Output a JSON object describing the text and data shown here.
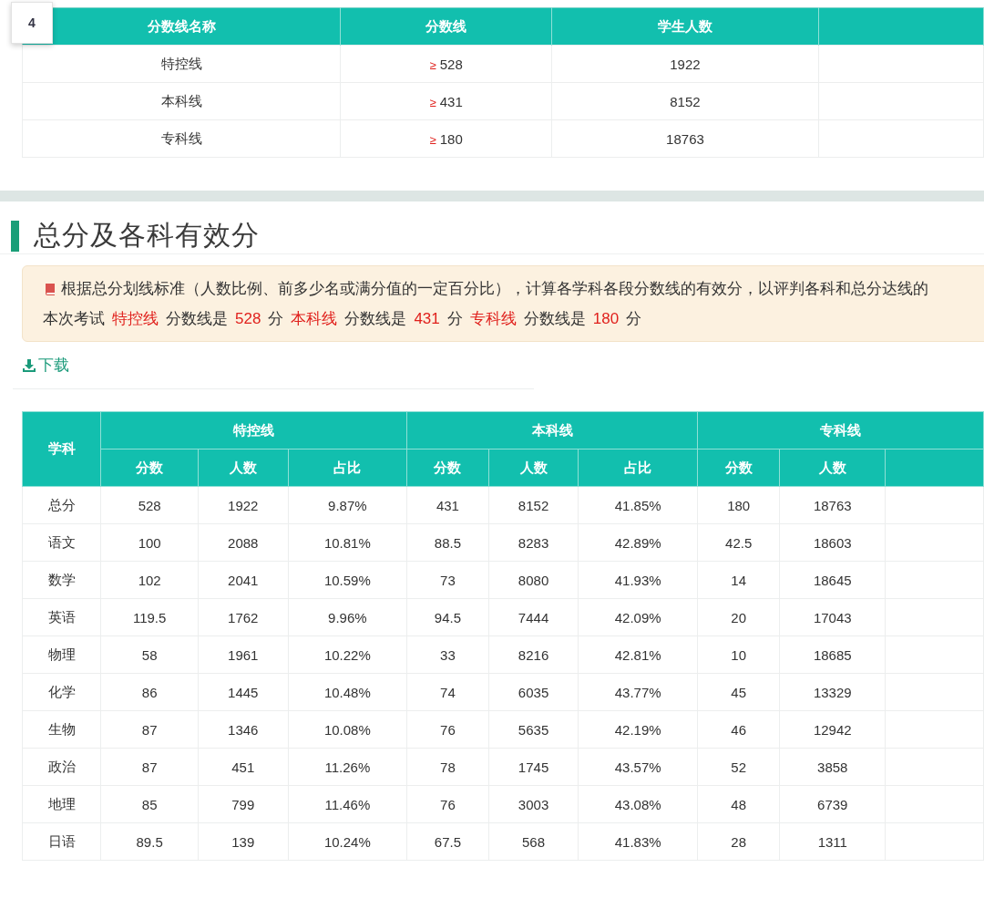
{
  "page_badge": "4",
  "cutoff_table": {
    "columns": [
      "分数线名称",
      "分数线",
      "学生人数"
    ],
    "rows": [
      {
        "name": "特控线",
        "sign": "≥",
        "score": "528",
        "students": "1922"
      },
      {
        "name": "本科线",
        "sign": "≥",
        "score": "431",
        "students": "8152"
      },
      {
        "name": "专科线",
        "sign": "≥",
        "score": "180",
        "students": "18763"
      }
    ]
  },
  "section": {
    "title": "总分及各科有效分",
    "notice": {
      "text": "根据总分划线标准（人数比例、前多少名或满分值的一定百分比），计算各学科各段分数线的有效分，以评判各科和总分达线的",
      "summary_prefix": "本次考试",
      "lines": [
        {
          "name": "特控线",
          "text": "分数线是",
          "score": "528",
          "unit": "分"
        },
        {
          "name": "本科线",
          "text": "分数线是",
          "score": "431",
          "unit": "分"
        },
        {
          "name": "专科线",
          "text": "分数线是",
          "score": "180",
          "unit": "分"
        }
      ]
    },
    "download": "下载",
    "table": {
      "subject_header": "学科",
      "groups": [
        {
          "name": "特控线",
          "columns": [
            "分数",
            "人数",
            "占比"
          ]
        },
        {
          "name": "本科线",
          "columns": [
            "分数",
            "人数",
            "占比"
          ]
        },
        {
          "name": "专科线",
          "columns": [
            "分数",
            "人数"
          ]
        }
      ],
      "rows": [
        [
          "总分",
          "528",
          "1922",
          "9.87%",
          "431",
          "8152",
          "41.85%",
          "180",
          "18763"
        ],
        [
          "语文",
          "100",
          "2088",
          "10.81%",
          "88.5",
          "8283",
          "42.89%",
          "42.5",
          "18603"
        ],
        [
          "数学",
          "102",
          "2041",
          "10.59%",
          "73",
          "8080",
          "41.93%",
          "14",
          "18645"
        ],
        [
          "英语",
          "119.5",
          "1762",
          "9.96%",
          "94.5",
          "7444",
          "42.09%",
          "20",
          "17043"
        ],
        [
          "物理",
          "58",
          "1961",
          "10.22%",
          "33",
          "8216",
          "42.81%",
          "10",
          "18685"
        ],
        [
          "化学",
          "86",
          "1445",
          "10.48%",
          "74",
          "6035",
          "43.77%",
          "45",
          "13329"
        ],
        [
          "生物",
          "87",
          "1346",
          "10.08%",
          "76",
          "5635",
          "42.19%",
          "46",
          "12942"
        ],
        [
          "政治",
          "87",
          "451",
          "11.26%",
          "78",
          "1745",
          "43.57%",
          "52",
          "3858"
        ],
        [
          "地理",
          "85",
          "799",
          "11.46%",
          "76",
          "3003",
          "43.08%",
          "48",
          "6739"
        ],
        [
          "日语",
          "89.5",
          "139",
          "10.24%",
          "67.5",
          "568",
          "41.83%",
          "28",
          "1311"
        ]
      ]
    }
  }
}
